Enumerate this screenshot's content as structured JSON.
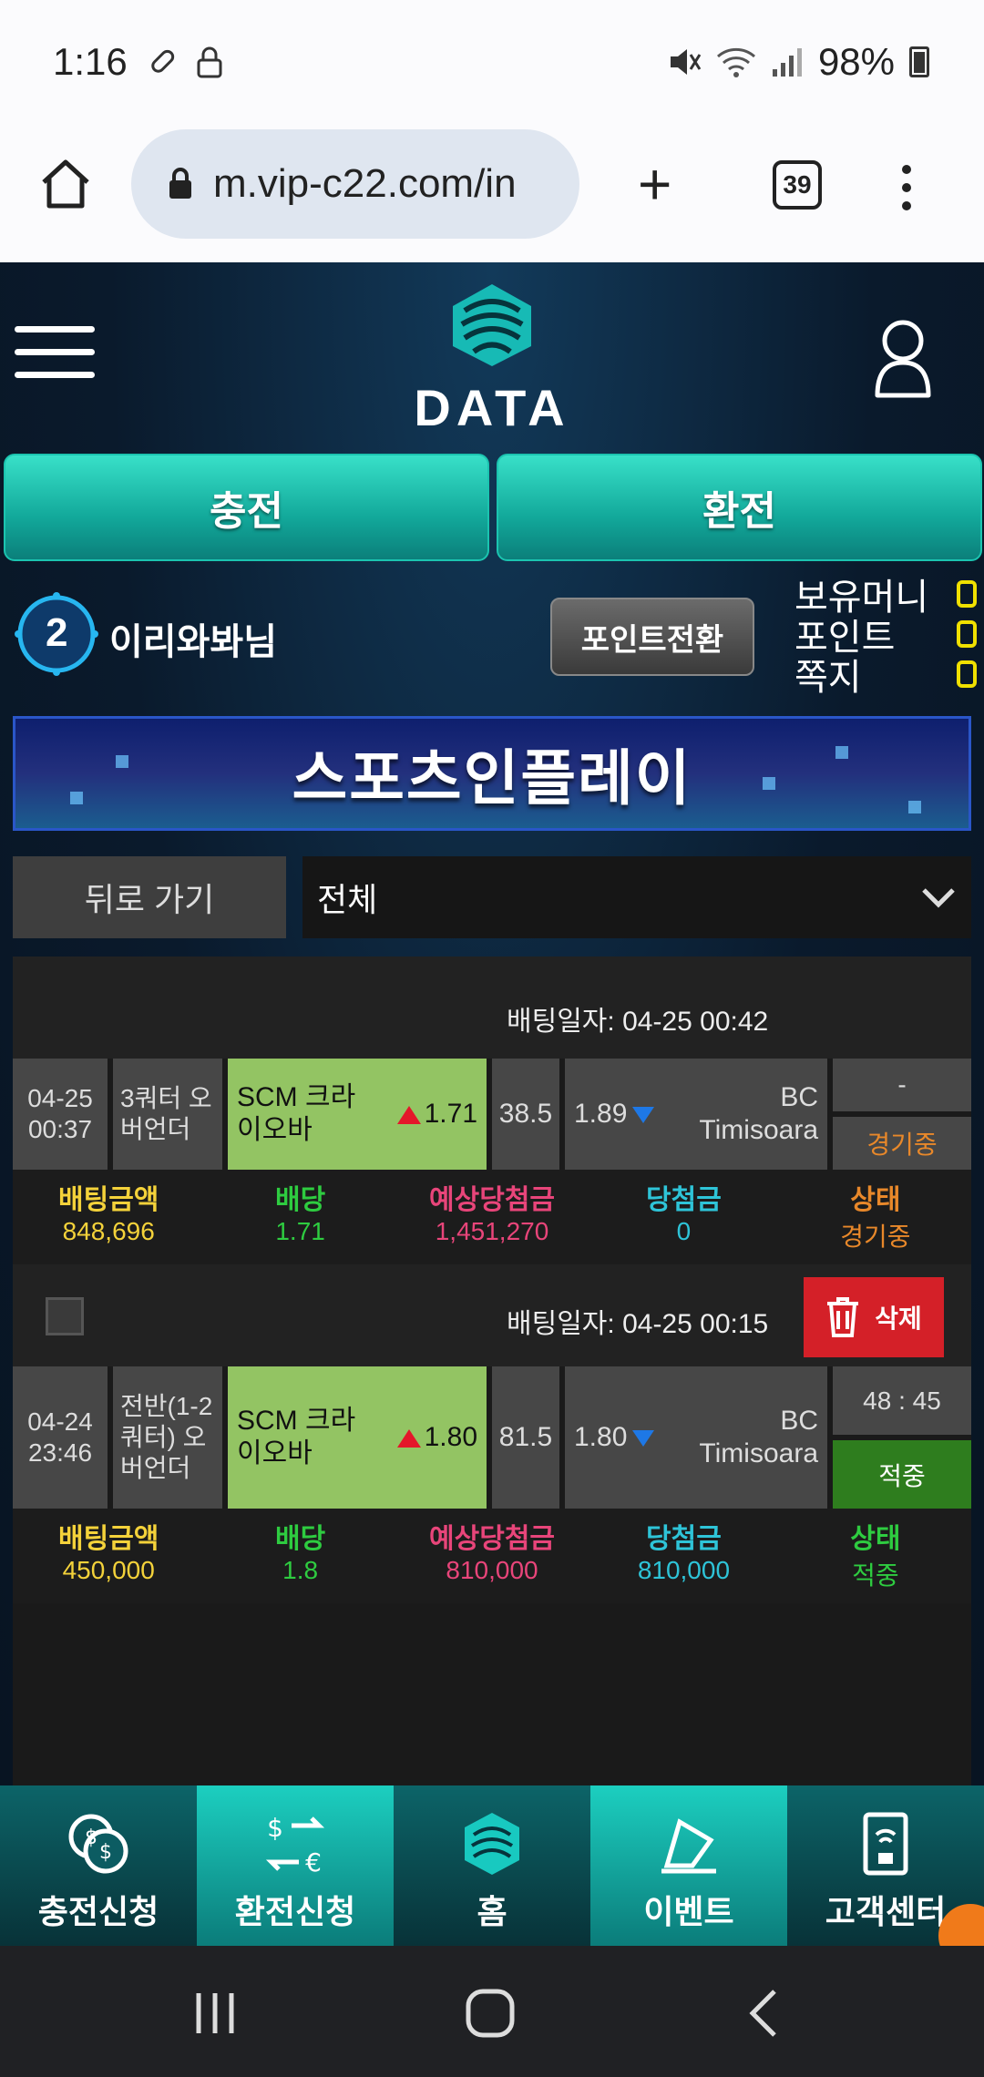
{
  "status_bar": {
    "time": "1:16",
    "battery": "98%"
  },
  "browser": {
    "url": "m.vip-c22.com/in",
    "tab_count": "39"
  },
  "header": {
    "logo_text": "DATA"
  },
  "actions": {
    "deposit": "충전",
    "withdraw": "환전"
  },
  "user": {
    "level": "2",
    "name": "이리와봐님",
    "point_convert": "포인트전환",
    "stats": [
      {
        "label": "보유머니",
        "value": "0"
      },
      {
        "label": "포인트",
        "value": "0"
      },
      {
        "label": "쪽지",
        "value": "0"
      }
    ]
  },
  "banner": {
    "title": "스포츠인플레이"
  },
  "filter": {
    "back": "뒤로 가기",
    "selected": "전체"
  },
  "summary_labels": {
    "bet_amount": "배팅금액",
    "odds": "배당",
    "expected": "예상당첨금",
    "won": "당첨금",
    "status": "상태"
  },
  "bets": [
    {
      "bet_date": "배팅일자: 04-25 00:42",
      "date": "04-25",
      "time": "00:37",
      "type": "3쿼터 오버언더",
      "home": "SCM 크라이오바",
      "home_odds": "1.71",
      "line": "38.5",
      "away_odds": "1.89",
      "away": "BC Timisoara",
      "score": "-",
      "game_status": "경기중",
      "bet_amount": "848,696",
      "odds": "1.71",
      "expected": "1,451,270",
      "won": "0",
      "status": "경기중"
    },
    {
      "bet_date": "배팅일자: 04-25 00:15",
      "delete": "삭제",
      "date": "04-24",
      "time": "23:46",
      "type": "전반(1-2쿼터) 오버언더",
      "home": "SCM 크라이오바",
      "home_odds": "1.80",
      "line": "81.5",
      "away_odds": "1.80",
      "away": "BC Timisoara",
      "score": "48 : 45",
      "game_status": "적중",
      "bet_amount": "450,000",
      "odds": "1.8",
      "expected": "810,000",
      "won": "810,000",
      "status": "적중"
    }
  ],
  "bottom_nav": [
    {
      "label": "충전신청",
      "icon": "coins-icon"
    },
    {
      "label": "환전신청",
      "icon": "exchange-icon"
    },
    {
      "label": "홈",
      "icon": "home-logo-icon"
    },
    {
      "label": "이벤트",
      "icon": "event-icon"
    },
    {
      "label": "고객센터",
      "icon": "support-icon"
    }
  ],
  "colors": {
    "teal": "#12a89a",
    "yellow": "#f0e000",
    "green_cell": "#93c463",
    "delete_red": "#d42028",
    "win_green": "#2e7d1e",
    "live_orange": "#e8882a"
  }
}
